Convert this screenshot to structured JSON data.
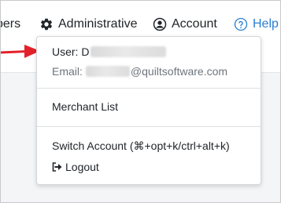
{
  "nav": {
    "cut_label": "bers",
    "admin_label": "Administrative",
    "account_label": "Account",
    "help_label": "Help"
  },
  "dropdown": {
    "user_label": "User: D",
    "email_label": "Email:",
    "email_domain": "@quiltsoftware.com",
    "merchant_list": "Merchant List",
    "switch_account": "Switch Account (⌘+opt+k/ctrl+alt+k)",
    "logout": "Logout"
  },
  "colors": {
    "arrow": "#e3212b",
    "help_link": "#2a7fd4",
    "text": "#212529",
    "muted_text": "#6c757d"
  },
  "icons": {
    "admin": "gear-icon",
    "account": "user-circle-icon",
    "help": "question-circle-icon",
    "logout": "sign-out-icon"
  }
}
